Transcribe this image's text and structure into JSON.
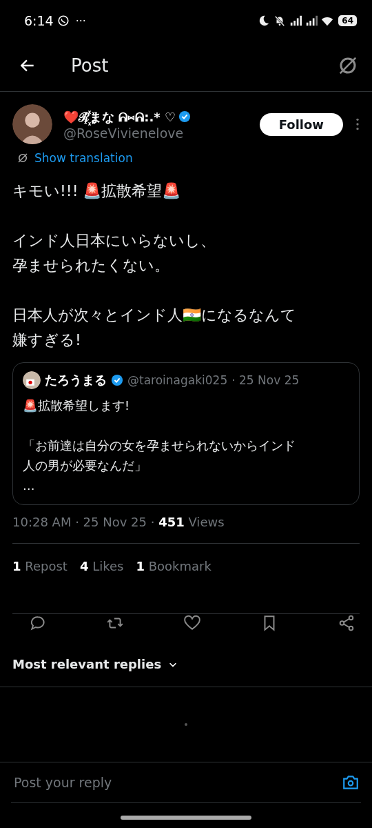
{
  "status_bar": {
    "time": "6:14",
    "overflow": "···",
    "battery": "64"
  },
  "header": {
    "title": "Post"
  },
  "post": {
    "display_name": "❤️ℛ꙰まな ᕱ⑅ᕱ:.* ♡",
    "verified": true,
    "handle": "@RoseVivienelove",
    "follow_label": "Follow",
    "translate_label": "Show translation",
    "paragraphs": [
      [
        "キモい!!!  🚨拡散希望🚨"
      ],
      [
        "インド人日本にいらないし、",
        "孕ませられたくない。"
      ],
      [
        "日本人が次々とインド人🇮🇳になるなんて",
        "嫌すぎる!"
      ]
    ],
    "quote": {
      "display_name": "たろうまる",
      "verified": true,
      "handle": "@taroinagaki025",
      "date": "· 25 Nov 25",
      "paragraphs": [
        [
          "🚨拡散希望します!"
        ],
        [
          "「お前達は自分の女を孕ませられないからインド",
          "人の男が必要なんだ」",
          "…"
        ]
      ]
    },
    "meta": {
      "time": "10:28 AM · 25 Nov 25 · ",
      "views_count": "451",
      "views_label": " Views"
    },
    "stats": [
      {
        "count": "1",
        "label": "Repost"
      },
      {
        "count": "4",
        "label": "Likes"
      },
      {
        "count": "1",
        "label": "Bookmark"
      }
    ],
    "actions": [
      {
        "kind": "reply"
      },
      {
        "kind": "repost"
      },
      {
        "kind": "like"
      },
      {
        "kind": "bookmark"
      },
      {
        "kind": "share"
      }
    ]
  },
  "replies_sort": {
    "label": "Most relevant replies"
  },
  "reply_bar": {
    "placeholder": "Post your reply"
  }
}
